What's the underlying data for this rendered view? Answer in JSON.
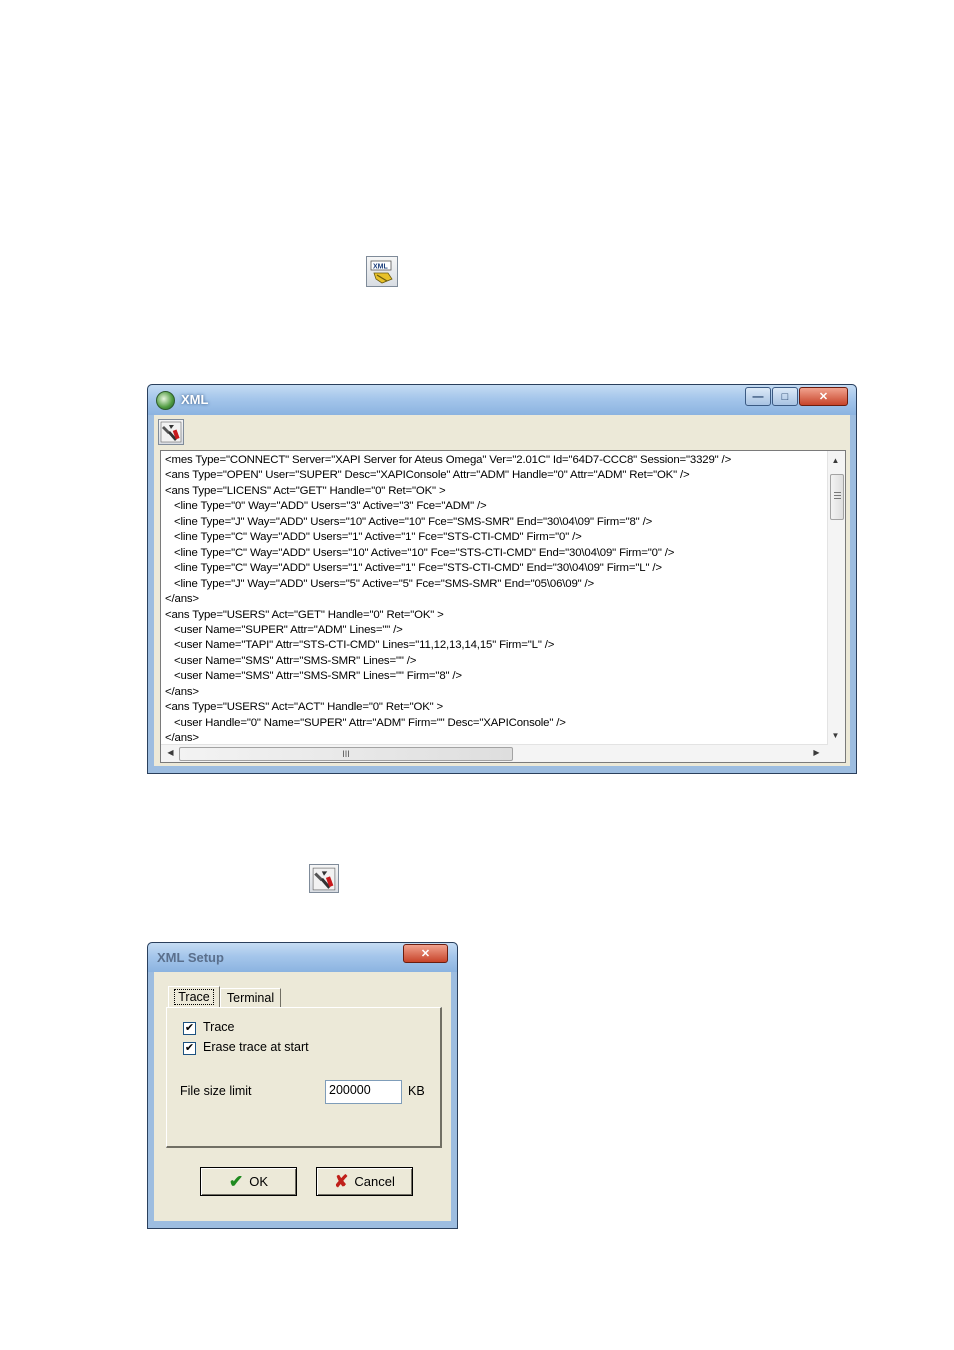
{
  "standalone_icons": {
    "xml_window_icon": "xml-icon",
    "setup_tool_icon": "tools-icon"
  },
  "xml_window": {
    "title": "XML",
    "caption_buttons": {
      "minimize": "—",
      "maximize": "□",
      "close": "✕"
    },
    "toolbar_icon": "tools-icon",
    "lines": [
      "<mes Type=\"CONNECT\" Server=\"XAPI Server for Ateus Omega\" Ver=\"2.01C\" Id=\"64D7-CCC8\" Session=\"3329\" />",
      "<ans Type=\"OPEN\" User=\"SUPER\" Desc=\"XAPIConsole\" Attr=\"ADM\" Handle=\"0\" Attr=\"ADM\" Ret=\"OK\" />",
      "<ans Type=\"LICENS\" Act=\"GET\" Handle=\"0\" Ret=\"OK\" >",
      "   <line Type=\"0\" Way=\"ADD\" Users=\"3\" Active=\"3\" Fce=\"ADM\" />",
      "   <line Type=\"J\" Way=\"ADD\" Users=\"10\" Active=\"10\" Fce=\"SMS-SMR\" End=\"30\\04\\09\" Firm=\"8\" />",
      "   <line Type=\"C\" Way=\"ADD\" Users=\"1\" Active=\"1\" Fce=\"STS-CTI-CMD\" Firm=\"0\" />",
      "   <line Type=\"C\" Way=\"ADD\" Users=\"10\" Active=\"10\" Fce=\"STS-CTI-CMD\" End=\"30\\04\\09\" Firm=\"0\" />",
      "   <line Type=\"C\" Way=\"ADD\" Users=\"1\" Active=\"1\" Fce=\"STS-CTI-CMD\" End=\"30\\04\\09\" Firm=\"L\" />",
      "   <line Type=\"J\" Way=\"ADD\" Users=\"5\" Active=\"5\" Fce=\"SMS-SMR\" End=\"05\\06\\09\" />",
      "</ans>",
      "<ans Type=\"USERS\" Act=\"GET\" Handle=\"0\" Ret=\"OK\" >",
      "   <user Name=\"SUPER\" Attr=\"ADM\" Lines=\"\" />",
      "   <user Name=\"TAPI\" Attr=\"STS-CTI-CMD\" Lines=\"11,12,13,14,15\" Firm=\"L\" />",
      "   <user Name=\"SMS\" Attr=\"SMS-SMR\" Lines=\"\" />",
      "   <user Name=\"SMS\" Attr=\"SMS-SMR\" Lines=\"\" Firm=\"8\" />",
      "</ans>",
      "<ans Type=\"USERS\" Act=\"ACT\" Handle=\"0\" Ret=\"OK\" >",
      "   <user Handle=\"0\" Name=\"SUPER\" Attr=\"ADM\" Firm=\"\" Desc=\"XAPIConsole\" />",
      "</ans>"
    ],
    "hscroll_thumb_label": "III"
  },
  "setup_dialog": {
    "title": "XML Setup",
    "close_glyph": "✕",
    "tabs": [
      "Trace",
      "Terminal"
    ],
    "active_tab": "Trace",
    "trace_checkbox": {
      "label": "Trace",
      "checked": true
    },
    "erase_checkbox": {
      "label": "Erase trace at start",
      "checked": true
    },
    "file_size": {
      "label": "File size limit",
      "value": "200000",
      "unit": "KB"
    },
    "ok_label": "OK",
    "cancel_label": "Cancel",
    "check_glyph": "✔"
  },
  "colors": {
    "ok_check": "#1f8a1f",
    "cancel_x": "#c0201a"
  }
}
